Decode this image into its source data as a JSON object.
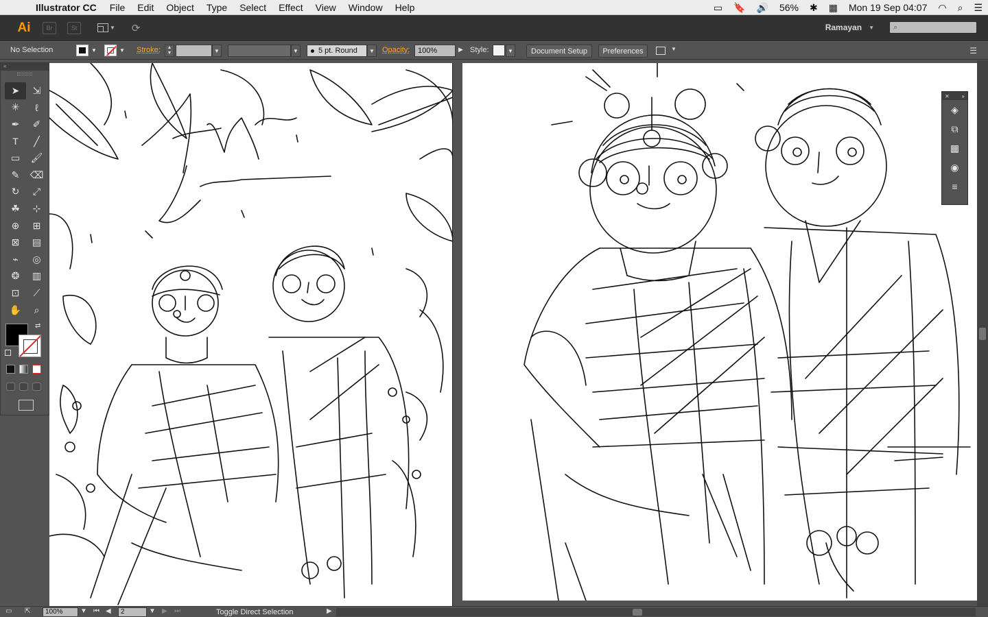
{
  "menubar": {
    "app_name": "Illustrator CC",
    "items": [
      "File",
      "Edit",
      "Object",
      "Type",
      "Select",
      "Effect",
      "View",
      "Window",
      "Help"
    ],
    "battery": "56%",
    "datetime": "Mon 19 Sep  04:07"
  },
  "appbar": {
    "logo": "Ai",
    "bridge": "Br",
    "stock": "St",
    "workspace": "Ramayan"
  },
  "control": {
    "selection": "No Selection",
    "stroke_label": "Stroke:",
    "brush": "5 pt. Round",
    "opacity_label": "Opacity:",
    "opacity_value": "100%",
    "style_label": "Style:",
    "document_setup": "Document Setup",
    "preferences": "Preferences"
  },
  "statusbar": {
    "zoom": "100%",
    "artboard": "2",
    "status_text": "Toggle Direct Selection"
  },
  "colors": {
    "accent": "#ff9a00",
    "orange_label": "#ffa33a",
    "ui_bg": "#535353",
    "app_bar": "#323232"
  },
  "icons": {
    "tools": [
      "selection-tool-icon",
      "direct-selection-tool-icon",
      "magic-wand-icon",
      "lasso-icon",
      "pen-icon",
      "curvature-icon",
      "type-icon",
      "line-segment-icon",
      "rectangle-icon",
      "paintbrush-icon",
      "pencil-icon",
      "eraser-icon",
      "rotate-icon",
      "scale-icon",
      "warp-icon",
      "free-transform-icon",
      "shape-builder-icon",
      "graph-icon",
      "mesh-icon",
      "gradient-icon",
      "eyedropper-icon",
      "blend-icon",
      "symbol-sprayer-icon",
      "column-graph-icon",
      "artboard-icon",
      "slice-icon",
      "hand-icon",
      "zoom-icon"
    ],
    "panels": [
      "layers-icon",
      "artboards-panel-icon",
      "swatches-icon",
      "appearance-icon",
      "menu-lines-icon"
    ]
  }
}
